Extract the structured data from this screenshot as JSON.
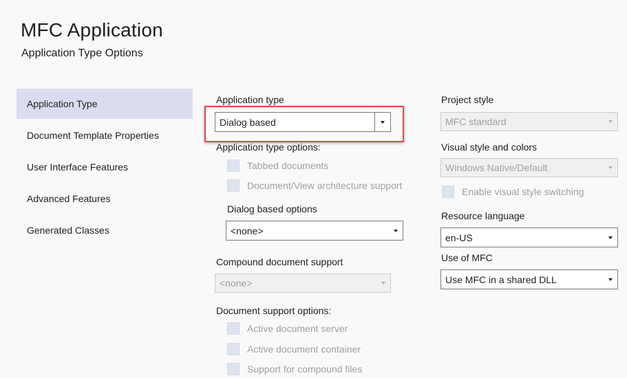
{
  "header": {
    "title": "MFC Application",
    "subtitle": "Application Type Options"
  },
  "sidebar": {
    "items": [
      {
        "label": "Application Type",
        "selected": true
      },
      {
        "label": "Document Template Properties",
        "selected": false
      },
      {
        "label": "User Interface Features",
        "selected": false
      },
      {
        "label": "Advanced Features",
        "selected": false
      },
      {
        "label": "Generated Classes",
        "selected": false
      }
    ]
  },
  "application_type": {
    "label": "Application type",
    "value": "Dialog based",
    "options_label": "Application type options:",
    "tabbed_documents": "Tabbed documents",
    "docview_support": "Document/View architecture support"
  },
  "dialog_options": {
    "label": "Dialog based options",
    "value": "<none>"
  },
  "compound_document": {
    "label": "Compound document support",
    "value": "<none>"
  },
  "document_support": {
    "label": "Document support options:",
    "active_server": "Active document server",
    "active_container": "Active document container",
    "compound_files": "Support for compound files"
  },
  "project_style": {
    "label": "Project style",
    "value": "MFC standard"
  },
  "visual_style": {
    "label": "Visual style and colors",
    "value": "Windows Native/Default",
    "switching": "Enable visual style switching"
  },
  "resource_language": {
    "label": "Resource language",
    "value": "en-US"
  },
  "use_mfc": {
    "label": "Use of MFC",
    "value": "Use MFC in a shared DLL"
  },
  "colors": {
    "highlight_border": "#e04848",
    "selected_nav": "#dcdcf0",
    "disabled_text": "#a0a0a0"
  }
}
